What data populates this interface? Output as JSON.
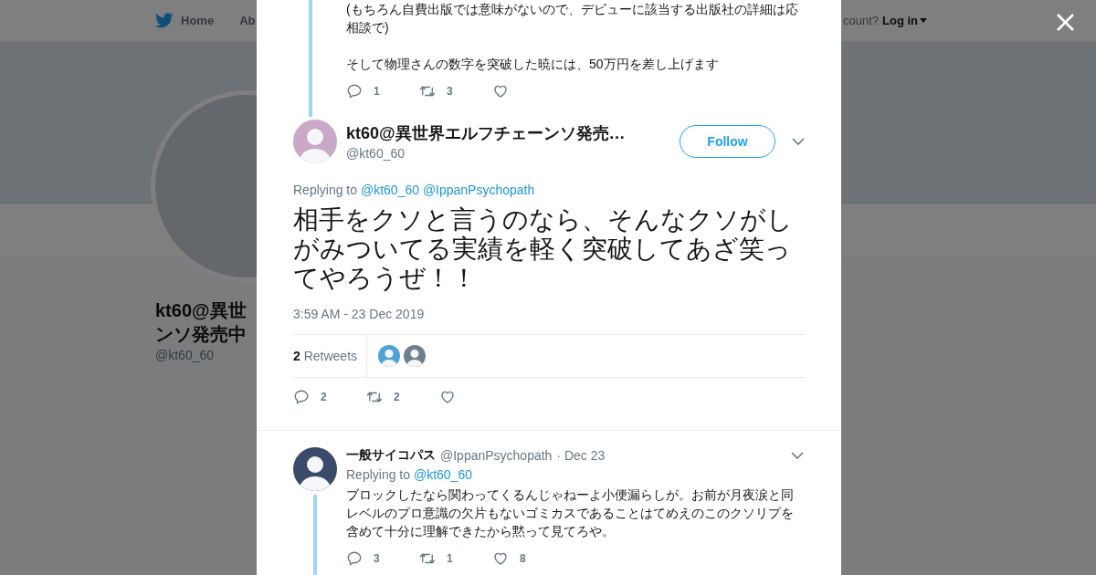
{
  "background_page": {
    "nav": {
      "home": "Home",
      "about": "Ab",
      "account_prompt": "count?",
      "login": "Log in"
    },
    "profile": {
      "name_lines": [
        "kt60@異世",
        "ンソ発売中"
      ],
      "handle": "@kt60_60"
    }
  },
  "previous_tweet": {
    "paragraphs": [
      "(もちろん自費出版では意味がないので、デビューに該当する出版社の詳細は応相談で)",
      "そして物理さんの数字を突破した暁には、50万円を差し上げます"
    ],
    "actions": [
      {
        "kind": "reply",
        "count": "1"
      },
      {
        "kind": "retweet",
        "count": "3"
      },
      {
        "kind": "like"
      }
    ]
  },
  "main_tweet": {
    "author": "kt60@異世界エルフチェーンソ発売…",
    "handle": "@kt60_60",
    "follow": "Follow",
    "replying_to": {
      "prefix": "Replying to",
      "mentions": [
        "@kt60_60",
        "@IppanPsychopath"
      ]
    },
    "text": "相手をクソと言うのなら、そんなクソがしがみついてる実績を軽く突破してあざ笑ってやろうぜ！！",
    "time": "3:59 AM - 23 Dec 2019",
    "retweets": {
      "count": "2",
      "label": "Retweets"
    },
    "actions": [
      {
        "kind": "reply",
        "count": "2"
      },
      {
        "kind": "retweet",
        "count": "2"
      },
      {
        "kind": "like"
      }
    ]
  },
  "reply": {
    "author": "一般サイコパス",
    "handle": "@IppanPsychopath",
    "date": "· Dec 23",
    "replying_to": {
      "prefix": "Replying to",
      "mentions": [
        "@kt60_60"
      ]
    },
    "text": "ブロックしたなら関わってくるんじゃねーよ小便漏らしが。お前が月夜涙と同レベルのプロ意識の欠片もないゴミカスであることはてめえのこのクソリプを含めて十分に理解できたから黙って見てろや。",
    "actions": [
      {
        "kind": "reply",
        "count": "3"
      },
      {
        "kind": "retweet",
        "count": "1"
      },
      {
        "kind": "like",
        "count": "8"
      }
    ]
  }
}
